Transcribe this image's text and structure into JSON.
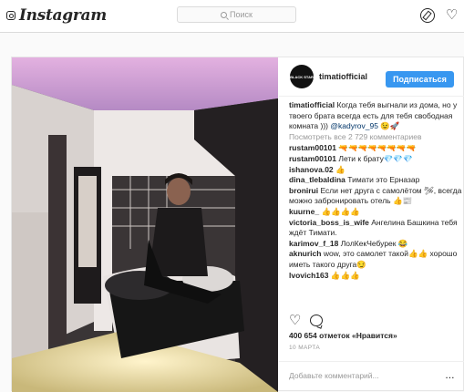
{
  "topbar": {
    "logo": "Instagram",
    "search_placeholder": "Поиск"
  },
  "post": {
    "username": "timatiofficial",
    "avatar_text": "BLACK STAR",
    "follow_label": "Подписаться",
    "caption_user": "timatiofficial",
    "caption_text": "Когда тебя выгнали из дома, но у твоего брата всегда есть для тебя свободная комната ))) ",
    "caption_tag": "@kadyrov_95",
    "caption_emoji": "😉🚀",
    "view_all": "Посмотреть все 2 729 комментариев",
    "comments": [
      {
        "user": "rustam00101",
        "text": "🔫🔫🔫🔫🔫🔫🔫🔫"
      },
      {
        "user": "rustam00101",
        "text": "Лети к брату💎💎💎"
      },
      {
        "user": "ishanova.02",
        "text": "👍"
      },
      {
        "user": "dina_tlebaldina",
        "text": "Тимати это Ерназар"
      },
      {
        "user": "bronirui",
        "text": "Если нет друга с самолётом 🛩, всегда можно забронировать отель 👍📰"
      },
      {
        "user": "kuurne_",
        "text": "👍👍👍👍"
      },
      {
        "user": "victoria_boss_is_wife",
        "text": "Ангелина Башкина тебя ждёт Тимати."
      },
      {
        "user": "karimov_f_18",
        "text": "ЛолКекЧебурек 😂"
      },
      {
        "user": "aknurich",
        "text": "wow, это самолет такой👍👍 хорошо иметь такого друга😏"
      },
      {
        "user": "lvovich163",
        "text": "👍👍👍"
      }
    ],
    "likes": "400 654 отметок «Нравится»",
    "date": "10 МАРТА",
    "add_comment_placeholder": "Добавьте комментарий...",
    "more_label": "..."
  },
  "colors": {
    "accent": "#3897f0",
    "ceiling_glow": "#d9a6d8"
  },
  "icons": [
    "instagram-logo-icon",
    "search-icon",
    "explore-compass-icon",
    "activity-heart-icon",
    "like-heart-icon",
    "comment-bubble-icon"
  ]
}
